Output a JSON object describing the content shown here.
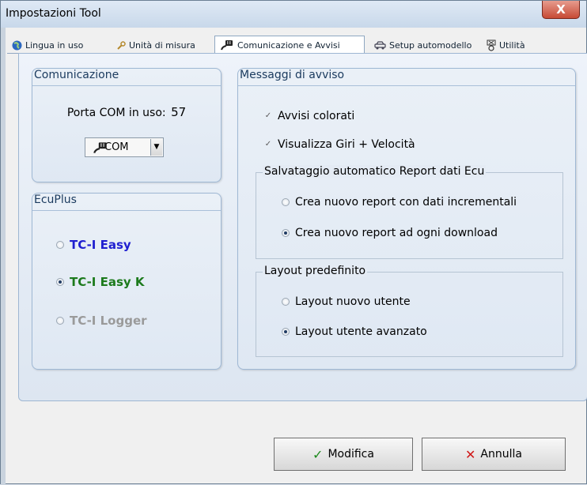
{
  "window": {
    "title": "Impostazioni Tool",
    "close_glyph": "X"
  },
  "tabs": [
    {
      "label": "Lingua in uso",
      "icon": "globe-icon"
    },
    {
      "label": "Unità di misura",
      "icon": "wrench-icon"
    },
    {
      "label": "Comunicazione e Avvisi",
      "icon": "connector-icon",
      "active": true
    },
    {
      "label": "Setup automodello",
      "icon": "car-icon"
    },
    {
      "label": "Utilità",
      "icon": "tools-icon"
    }
  ],
  "comunicazione": {
    "title": "Comunicazione",
    "port_label": "Porta COM in uso:",
    "port_value": "57",
    "combo_value": "COM",
    "combo_icon": "connector-icon"
  },
  "ecuplus": {
    "title": "EcuPlus",
    "options": [
      {
        "label": "TC-I Easy",
        "color": "#1f1fd0",
        "selected": false
      },
      {
        "label": "TC-I Easy K",
        "color": "#1c7a1c",
        "selected": true
      },
      {
        "label": "TC-I Logger",
        "color": "#9a9a9a",
        "selected": false
      }
    ]
  },
  "messaggi": {
    "title": "Messaggi di avviso",
    "check_colorati": "Avvisi colorati",
    "check_giri": "Visualizza Giri + Velocità",
    "salvataggio": {
      "title": "Salvataggio automatico Report dati Ecu",
      "opt_incrementali": "Crea nuovo report con dati incrementali",
      "opt_download": "Crea nuovo report ad ogni download"
    },
    "layout": {
      "title": "Layout predefinito",
      "opt_nuovo": "Layout nuovo utente",
      "opt_avanzato": "Layout utente avanzato"
    }
  },
  "buttons": {
    "modifica": {
      "label": "Modifica",
      "icon_glyph": "✓",
      "color": "#1c8a1c"
    },
    "annulla": {
      "label": "Annulla",
      "icon_glyph": "✕",
      "color": "#d01818"
    }
  }
}
